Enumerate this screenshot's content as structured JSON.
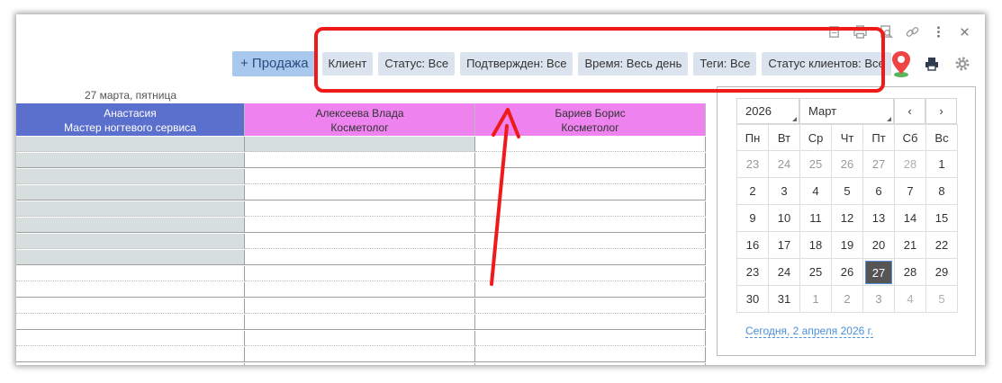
{
  "header_icons": [
    "document-icon",
    "print-icon",
    "search-doc-icon",
    "link-icon",
    "more-vertical-icon",
    "close-icon"
  ],
  "toolbar": {
    "sale_label": "+ Продажа",
    "filters": [
      "Клиент",
      "Статус: Все",
      "Подтвержден: Все",
      "Время: Весь день",
      "Теги: Все",
      "Статус клиентов: Все"
    ]
  },
  "schedule": {
    "date_label": "27 марта, пятница",
    "staff": [
      {
        "name": "Анастасия",
        "role": "Мастер ногтевого сервиса",
        "color": "#5b6fcc"
      },
      {
        "name": "Алексеева Влада",
        "role": "Косметолог",
        "color": "#ee82ee"
      },
      {
        "name": "Бариев Борис",
        "role": "Косметолог",
        "color": "#ee82ee"
      }
    ]
  },
  "calendar": {
    "year": "2026",
    "month": "Март",
    "prev": "‹",
    "next": "›",
    "weekdays": [
      "Пн",
      "Вт",
      "Ср",
      "Чт",
      "Пт",
      "Сб",
      "Вс"
    ],
    "weeks": [
      [
        "23",
        "24",
        "25",
        "26",
        "27",
        "28",
        "1"
      ],
      [
        "2",
        "3",
        "4",
        "5",
        "6",
        "7",
        "8"
      ],
      [
        "9",
        "10",
        "11",
        "12",
        "13",
        "14",
        "15"
      ],
      [
        "16",
        "17",
        "18",
        "19",
        "20",
        "21",
        "22"
      ],
      [
        "23",
        "24",
        "25",
        "26",
        "27",
        "28",
        "29"
      ],
      [
        "30",
        "31",
        "1",
        "2",
        "3",
        "4",
        "5"
      ]
    ],
    "selected": "27",
    "today_link": "Сегодня, 2 апреля 2026 г."
  },
  "colors": {
    "highlight": "#ef1b1b",
    "weekend": "#e0401a",
    "accent": "#4a90d9"
  }
}
